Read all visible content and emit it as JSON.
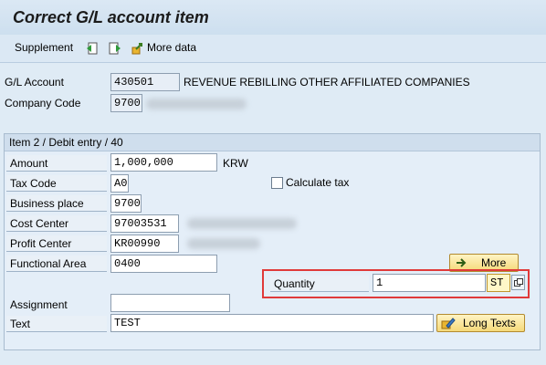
{
  "title": "Correct G/L account item",
  "toolbar": {
    "supplement_label": "Supplement",
    "more_data_label": "More data"
  },
  "header": {
    "gl_account_label": "G/L Account",
    "gl_account_value": "430501",
    "gl_account_text": "REVENUE REBILLING OTHER AFFILIATED COMPANIES",
    "company_code_label": "Company Code",
    "company_code_value": "9700"
  },
  "item": {
    "group_title": "Item 2 / Debit entry / 40",
    "amount_label": "Amount",
    "amount_value": "1,000,000",
    "currency": "KRW",
    "tax_code_label": "Tax Code",
    "tax_code_value": "A0",
    "calculate_tax_label": "Calculate tax",
    "calculate_tax_checked": false,
    "business_place_label": "Business place",
    "business_place_value": "9700",
    "cost_center_label": "Cost Center",
    "cost_center_value": "97003531",
    "profit_center_label": "Profit Center",
    "profit_center_value": "KR00990",
    "functional_area_label": "Functional Area",
    "functional_area_value": "0400",
    "more_button_label": "More",
    "quantity_label": "Quantity",
    "quantity_value": "1",
    "quantity_unit": "ST",
    "assignment_label": "Assignment",
    "assignment_value": "",
    "text_label": "Text",
    "text_value": "TEST",
    "long_texts_label": "Long Texts"
  },
  "colors": {
    "highlight": "#e03a3a",
    "button_bg": "#f5d97a"
  }
}
